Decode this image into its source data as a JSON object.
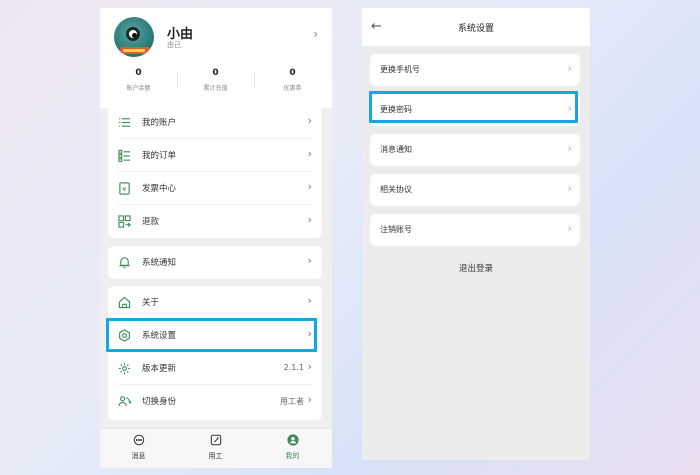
{
  "profile": {
    "name": "小由",
    "subtitle": "由己",
    "stats": [
      {
        "value": "0",
        "label": "账户余额"
      },
      {
        "value": "0",
        "label": "累计充值"
      },
      {
        "value": "0",
        "label": "优惠券"
      }
    ]
  },
  "menu_group1": [
    {
      "label": "我的账户",
      "icon": "list-icon"
    },
    {
      "label": "我的订单",
      "icon": "order-list-icon"
    },
    {
      "label": "发票中心",
      "icon": "invoice-icon"
    },
    {
      "label": "退款",
      "icon": "refund-icon"
    }
  ],
  "menu_group2": [
    {
      "label": "系统通知",
      "icon": "bell-icon"
    }
  ],
  "menu_group3": [
    {
      "label": "关于",
      "icon": "home-icon",
      "value": ""
    },
    {
      "label": "系统设置",
      "icon": "settings-icon",
      "value": ""
    },
    {
      "label": "版本更新",
      "icon": "update-icon",
      "value": "2.1.1"
    },
    {
      "label": "切换身份",
      "icon": "switch-identity-icon",
      "value": "用工者"
    }
  ],
  "tabs": [
    {
      "label": "消息",
      "icon": "message-icon",
      "active": false
    },
    {
      "label": "用工",
      "icon": "edit-icon",
      "active": false
    },
    {
      "label": "我的",
      "icon": "user-icon",
      "active": true
    }
  ],
  "settings_page": {
    "title": "系统设置",
    "items": [
      "更换手机号",
      "更换密码",
      "消息通知",
      "相关协议",
      "注销账号"
    ],
    "logout": "退出登录"
  },
  "colors": {
    "accent": "#3d8b5a",
    "highlight": "#10a8e6"
  }
}
